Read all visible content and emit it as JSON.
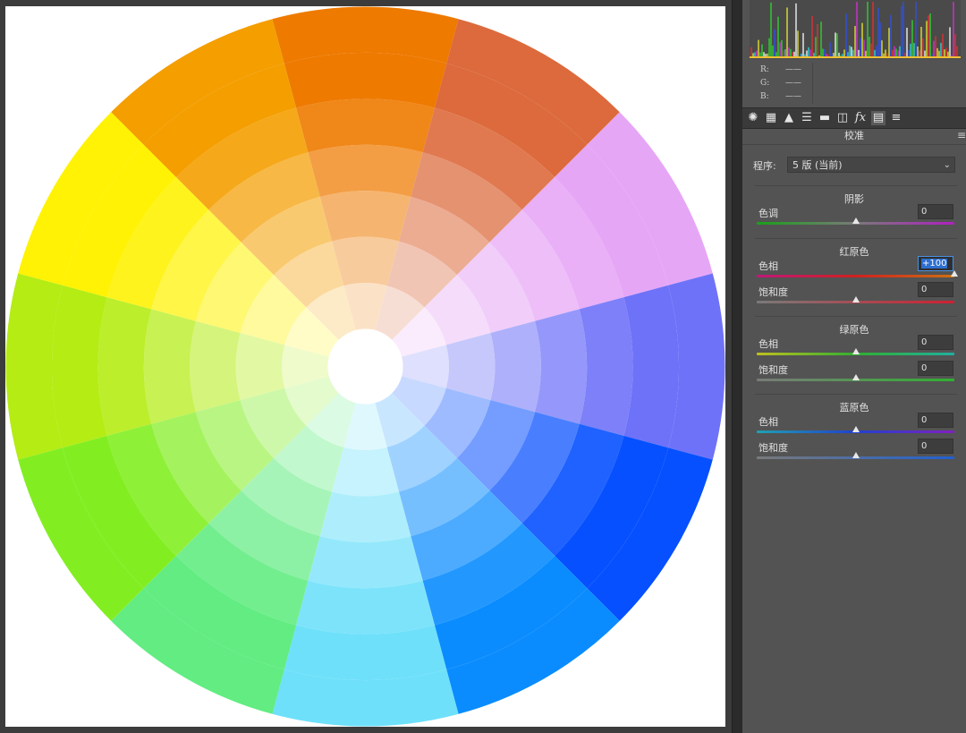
{
  "histogram": {
    "rgb_labels": [
      "R:",
      "G:",
      "B:"
    ],
    "rgb_values": [
      "——",
      "——",
      "——"
    ]
  },
  "tabs": [
    {
      "icon": "basic-icon",
      "glyph": "✺"
    },
    {
      "icon": "tone-curve-icon",
      "glyph": "▦"
    },
    {
      "icon": "detail-icon",
      "glyph": "▲"
    },
    {
      "icon": "hsl-icon",
      "glyph": "☰"
    },
    {
      "icon": "split-toning-icon",
      "glyph": "▬"
    },
    {
      "icon": "lens-icon",
      "glyph": "◫"
    },
    {
      "icon": "effects-icon",
      "glyph": "fx"
    },
    {
      "icon": "camera-calibration-icon",
      "glyph": "▤"
    },
    {
      "icon": "presets-icon",
      "glyph": "≡"
    }
  ],
  "panel": {
    "title": "校准",
    "process_label": "程序:",
    "process_value": "5 版 (当前)"
  },
  "groups": {
    "shadows": {
      "title": "阴影",
      "tint_label": "色调",
      "tint_value": "0",
      "tint_level": 0.5
    },
    "red": {
      "title": "红原色",
      "hue_label": "色相",
      "hue_value": "+100",
      "hue_level": 1.0,
      "sat_label": "饱和度",
      "sat_value": "0",
      "sat_level": 0.5
    },
    "green": {
      "title": "绿原色",
      "hue_label": "色相",
      "hue_value": "0",
      "hue_level": 0.5,
      "sat_label": "饱和度",
      "sat_value": "0",
      "sat_level": 0.5
    },
    "blue": {
      "title": "蓝原色",
      "hue_label": "色相",
      "hue_value": "0",
      "hue_level": 0.5,
      "sat_label": "饱和度",
      "sat_value": "0",
      "sat_level": 0.5
    }
  },
  "colors": {
    "panel_bg": "#535353",
    "canvas_bg": "#3c3c3c",
    "focus": "#4a90e2"
  },
  "wheel": {
    "segments": [
      "#ee7a00",
      "#dc6a3c",
      "#e6a6f6",
      "#6e72f8",
      "#0650ff",
      "#0a8cff",
      "#6ee0fa",
      "#62ec82",
      "#82ee22",
      "#b4ec14",
      "#fff204",
      "#f49e00"
    ]
  }
}
